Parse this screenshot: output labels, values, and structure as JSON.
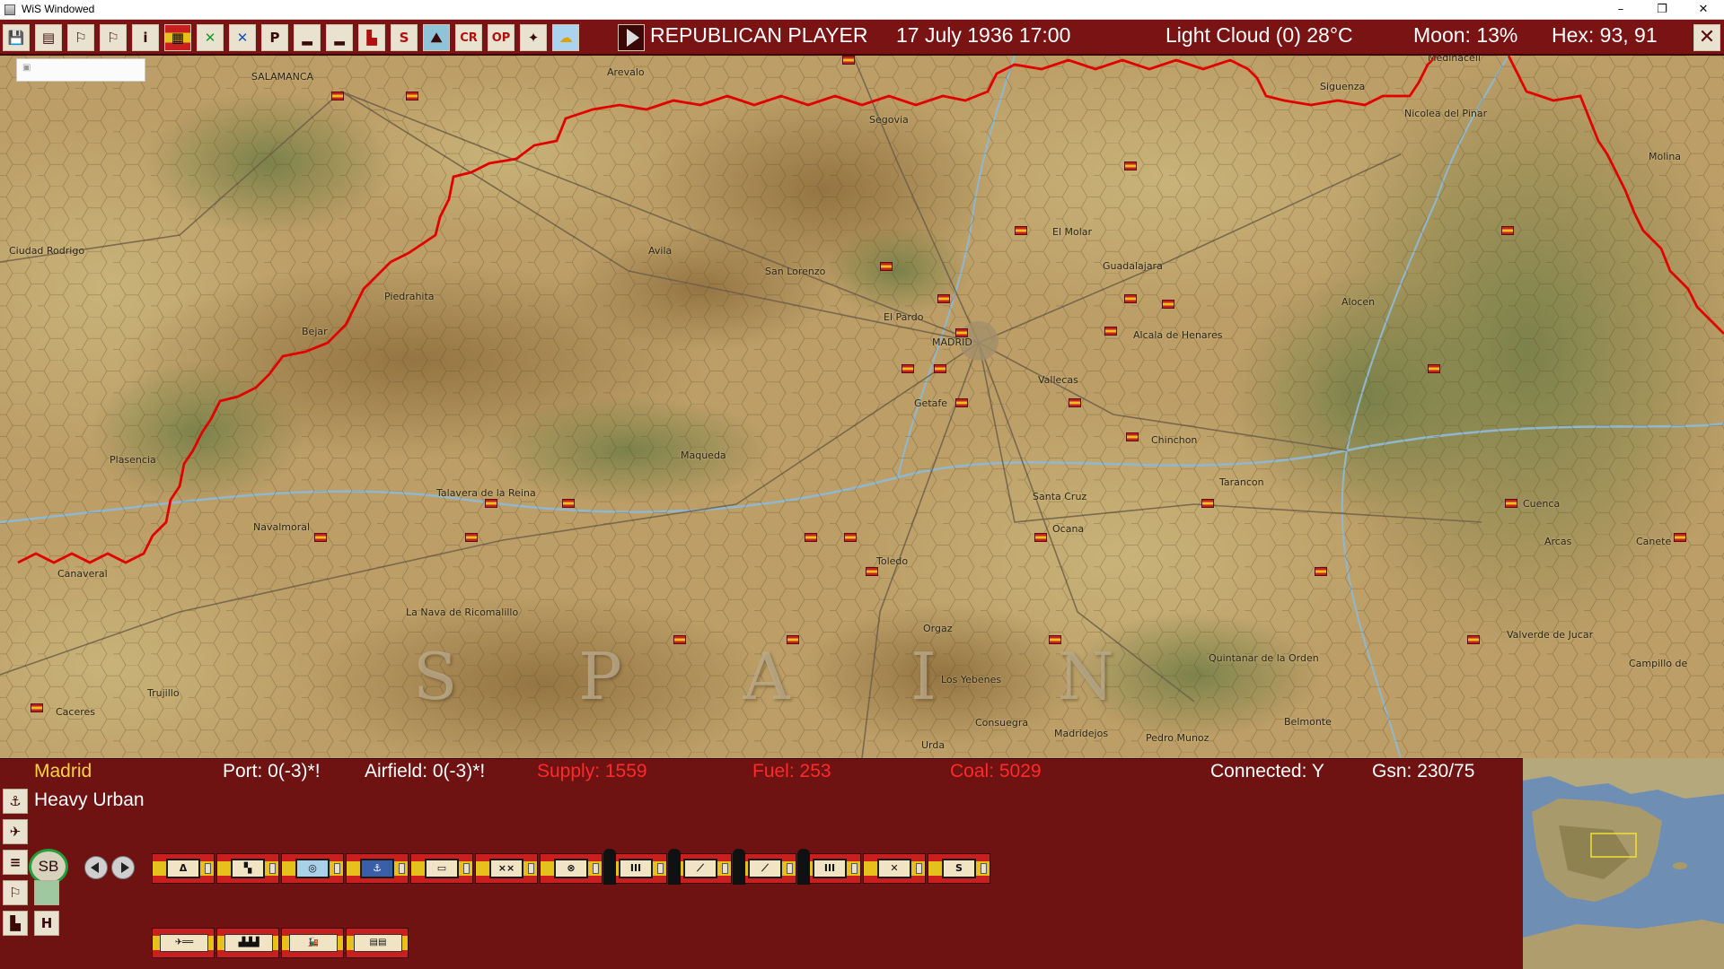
{
  "window": {
    "title": "WiS Windowed",
    "minimize": "–",
    "restore": "❐",
    "close": "✕"
  },
  "toolbar": {
    "buttons": [
      "💾",
      "▤",
      "⚐",
      "⚐",
      "i",
      "▦",
      "✕",
      "✕",
      "P",
      "▂",
      "▂",
      "▙",
      "S",
      "⛰",
      "CR",
      "OP",
      "✦",
      "☁"
    ],
    "player": "REPUBLICAN PLAYER",
    "date": "17 July 1936 17:00",
    "weather": "Light Cloud (0) 28°C",
    "moon": "Moon: 13%",
    "hex": "Hex: 93, 91",
    "close": "✕"
  },
  "map": {
    "label": "S P A I N",
    "towns": [
      {
        "name": "SALAMANCA"
      },
      {
        "name": "Arevalo"
      },
      {
        "name": "Segovia"
      },
      {
        "name": "Siguenza"
      },
      {
        "name": "Medinaceli"
      },
      {
        "name": "Nicolea del Pinar"
      },
      {
        "name": "Molina"
      },
      {
        "name": "Ciudad Rodrigo"
      },
      {
        "name": "Avila"
      },
      {
        "name": "El Molar"
      },
      {
        "name": "Guadalajara"
      },
      {
        "name": "San Lorenzo"
      },
      {
        "name": "Piedrahita"
      },
      {
        "name": "Alocen"
      },
      {
        "name": "El Pardo"
      },
      {
        "name": "Bejar"
      },
      {
        "name": "MADRID"
      },
      {
        "name": "Alcala de Henares"
      },
      {
        "name": "Vallecas"
      },
      {
        "name": "Getafe"
      },
      {
        "name": "Chinchon"
      },
      {
        "name": "Plasencia"
      },
      {
        "name": "Maqueda"
      },
      {
        "name": "Talavera de la Reina"
      },
      {
        "name": "Tarancon"
      },
      {
        "name": "Santa Cruz"
      },
      {
        "name": "Cuenca"
      },
      {
        "name": "Navalmoral"
      },
      {
        "name": "Ocana"
      },
      {
        "name": "Arcas"
      },
      {
        "name": "Canete"
      },
      {
        "name": "Canaveral"
      },
      {
        "name": "Toledo"
      },
      {
        "name": "La Nava de Ricomalillo"
      },
      {
        "name": "Orgaz"
      },
      {
        "name": "Valverde de Jucar"
      },
      {
        "name": "Quintanar de la Orden"
      },
      {
        "name": "Campillo de"
      },
      {
        "name": "Trujillo"
      },
      {
        "name": "Los Yebenes"
      },
      {
        "name": "Caceres"
      },
      {
        "name": "Belmonte"
      },
      {
        "name": "Consuegra"
      },
      {
        "name": "Madridejos"
      },
      {
        "name": "Urda"
      },
      {
        "name": "Pedro Munoz"
      }
    ]
  },
  "status": {
    "location": "Madrid",
    "terrain": "Heavy Urban",
    "port": "Port: 0(-3)*!",
    "airfield": "Airfield: 0(-3)*!",
    "supply": "Supply: 1559",
    "fuel": "Fuel: 253",
    "coal": "Coal: 5029",
    "connected": "Connected: Y",
    "garrison": "Gsn: 230/75"
  },
  "side_buttons": [
    "⚓",
    "✈",
    "≡",
    "⚐",
    "▙"
  ],
  "sb_label": "SB",
  "h_label": "H",
  "units": [
    "Δ",
    "▚",
    "◎",
    "⚓",
    "▭",
    "××",
    "⊗",
    "III",
    "⟋",
    "⟋",
    "III",
    "✕",
    "S"
  ],
  "builds": [
    "✈══",
    "▟▟▟",
    "🚂",
    "▤▤"
  ],
  "colors": {
    "bar": "#7a1414",
    "panel": "#6f1212",
    "location": "#ffd24a",
    "supply": "#ff2a2a",
    "frontline": "#e00000",
    "sb_ring": "#23a03c"
  }
}
